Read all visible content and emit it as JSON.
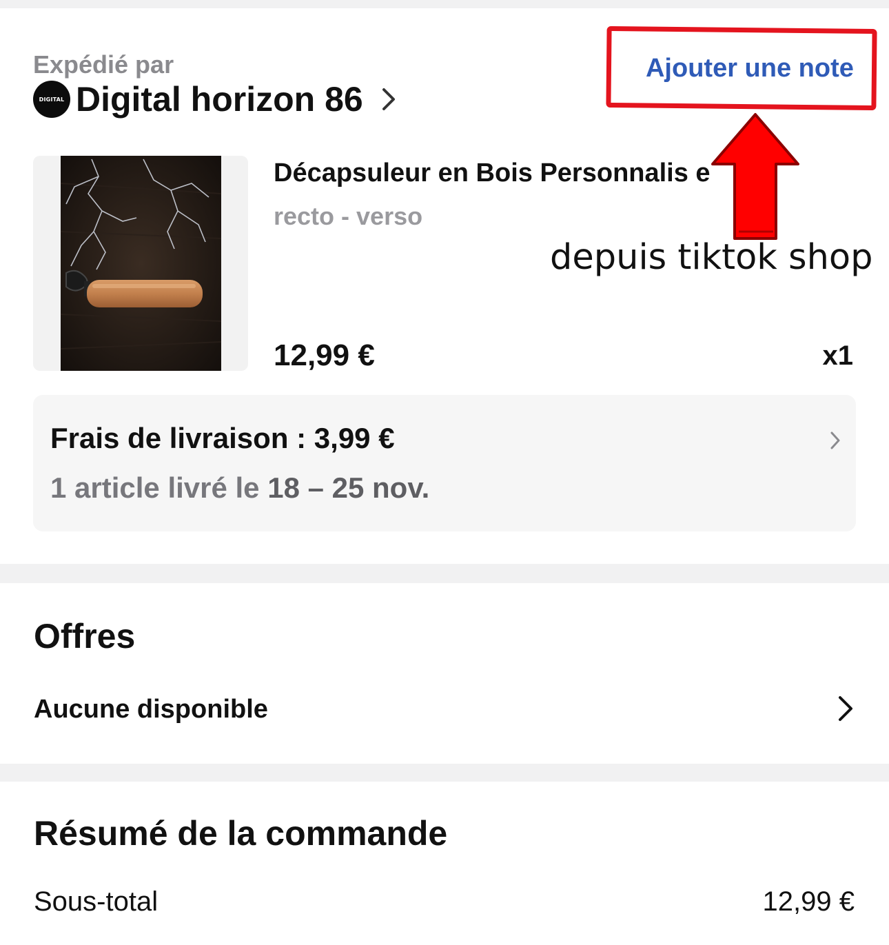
{
  "shipping_section": {
    "shipped_by_label": "Expédié par",
    "seller": {
      "logo_text": "DIGITAL",
      "name": "Digital horizon 86"
    },
    "add_note_label": "Ajouter une note"
  },
  "product": {
    "title": "Décapsuleur en Bois Personnalisé",
    "title_visible": "Décapsuleur en Bois Personnalis e",
    "variant": "recto - verso",
    "price": "12,99 €",
    "quantity": "x1"
  },
  "annotation": {
    "text": "depuis tiktok shop",
    "highlight_color": "#e4141e",
    "arrow_color": "#ff0000"
  },
  "delivery": {
    "fee_text": "Frais de livraison : 3,99 €",
    "eta_prefix": "1 article livré le ",
    "eta_dates": "18 – 25 nov."
  },
  "offers": {
    "title": "Offres",
    "value": "Aucune disponible"
  },
  "summary": {
    "title": "Résumé de la commande",
    "subtotal_label": "Sous-total",
    "subtotal_value": "12,99 €"
  },
  "colors": {
    "link_blue": "#2f5bb7",
    "text_primary": "#111111",
    "text_muted": "#8a8a8e",
    "section_divider": "#f1f1f2"
  },
  "icons": [
    "chevron-right-icon",
    "up-arrow-annotation"
  ]
}
